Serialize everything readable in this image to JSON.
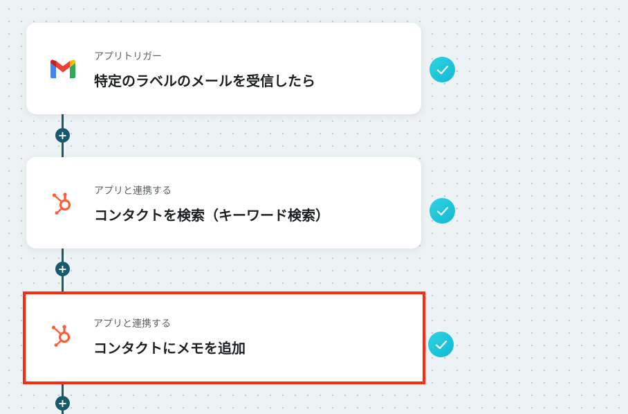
{
  "flow": {
    "steps": [
      {
        "type_label": "アプリトリガー",
        "title": "特定のラベルのメールを受信したら",
        "app_icon": "gmail-icon",
        "status": "complete"
      },
      {
        "type_label": "アプリと連携する",
        "title": "コンタクトを検索（キーワード検索）",
        "app_icon": "hubspot-icon",
        "status": "complete"
      },
      {
        "type_label": "アプリと連携する",
        "title": "コンタクトにメモを追加",
        "app_icon": "hubspot-icon",
        "status": "complete",
        "highlighted": true
      }
    ],
    "add_button_label": "+"
  },
  "colors": {
    "background": "#edf3f4",
    "connector": "#1c5a6b",
    "check_gradient_start": "#2fd3e0",
    "check_gradient_end": "#12b9d3",
    "highlight_border": "#ff2a0f",
    "hubspot_orange": "#ff5c35"
  }
}
